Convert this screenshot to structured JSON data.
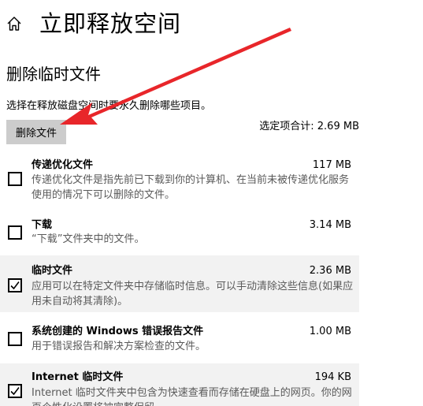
{
  "header": {
    "title": "立即释放空间"
  },
  "section": {
    "title": "删除临时文件"
  },
  "instruction": "选择在释放磁盘空间时要永久删除哪些项目。",
  "delete_button": "删除文件",
  "total": "选定项合计: 2.69 MB",
  "items": [
    {
      "title": "传递优化文件",
      "size": "117 MB",
      "desc": "传递优化文件是指先前已下载到你的计算机、在当前未被传递优化服务使用的情况下可以删除的文件。",
      "checked": false
    },
    {
      "title": "下载",
      "size": "3.14 MB",
      "desc": "“下载”文件夹中的文件。",
      "checked": false
    },
    {
      "title": "临时文件",
      "size": "2.36 MB",
      "desc": "应用可以在特定文件夹中存储临时信息。可以手动清除这些信息(如果应用未自动将其清除)。",
      "checked": true
    },
    {
      "title": "系统创建的 Windows 错误报告文件",
      "size": "1.00 MB",
      "desc": "用于错误报告和解决方案检查的文件。",
      "checked": false
    },
    {
      "title": "Internet 临时文件",
      "size": "194 KB",
      "desc": "Internet 临时文件夹中包含为快速查看而存储在硬盘上的网页。你的网页个性化设置将被完整保留。",
      "checked": true
    }
  ],
  "colors": {
    "annotation_arrow": "#e8262a",
    "checked_bg": "#f2f2f2",
    "button_bg": "#cccccc"
  },
  "icons": {
    "home": "home-icon",
    "check": "checkmark-icon",
    "arrow": "annotation-arrow"
  }
}
